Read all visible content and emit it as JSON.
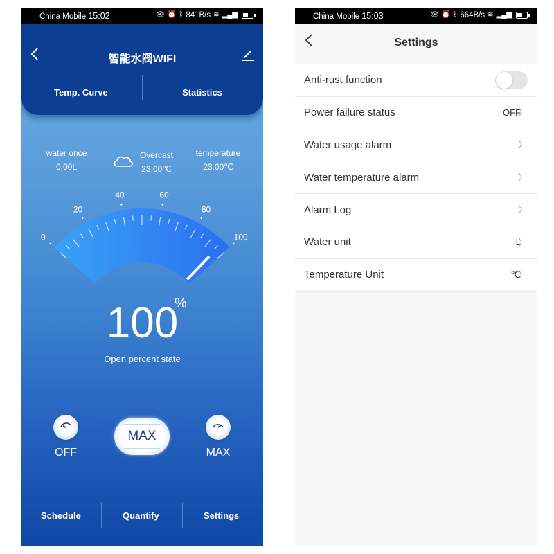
{
  "left": {
    "status_bar": {
      "carrier": "China Mobile",
      "time": "15:02",
      "speed": "841B/s"
    },
    "header": {
      "title": "智能水阀WIFI",
      "tabs": [
        {
          "label": "Temp. Curve"
        },
        {
          "label": "Statistics"
        }
      ]
    },
    "info": {
      "water_once": {
        "label": "water once",
        "value": "0.00L"
      },
      "weather": {
        "label": "Overcast",
        "value": "23.00℃",
        "icon": "cloud-icon"
      },
      "temperature": {
        "label": "temperature",
        "value": "23.00℃"
      }
    },
    "gauge": {
      "min": 0,
      "max": 100,
      "value": 100,
      "tick_labels": [
        "0",
        "20",
        "40",
        "60",
        "80",
        "100"
      ],
      "colors": {
        "arc_start": "#3aa2f6",
        "arc_end": "#2b6ff0"
      }
    },
    "reading": {
      "value": "100",
      "unit": "%",
      "label": "Open percent state"
    },
    "controls": {
      "off_label": "OFF",
      "center_label": "MAX",
      "max_label": "MAX"
    },
    "bottom_nav": [
      {
        "label": "Schedule"
      },
      {
        "label": "Quantify"
      },
      {
        "label": "Settings"
      }
    ]
  },
  "right": {
    "status_bar": {
      "carrier": "China Mobile",
      "time": "15:03",
      "speed": "664B/s"
    },
    "header": {
      "title": "Settings"
    },
    "settings": [
      {
        "label": "Anti-rust function",
        "type": "toggle",
        "on": false
      },
      {
        "label": "Power failure status",
        "value": "OFF",
        "type": "link"
      },
      {
        "label": "Water usage alarm",
        "value": "",
        "type": "link"
      },
      {
        "label": "Water temperature alarm",
        "value": "",
        "type": "link"
      },
      {
        "label": "Alarm Log",
        "value": "",
        "type": "link"
      },
      {
        "label": "Water unit",
        "value": "L",
        "type": "link"
      },
      {
        "label": "Temperature Unit",
        "value": "℃",
        "type": "link"
      }
    ]
  }
}
